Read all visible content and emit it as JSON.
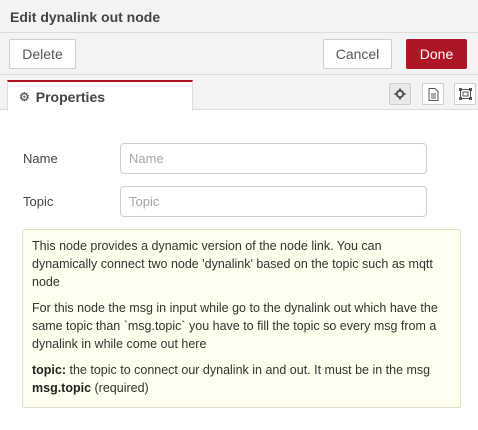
{
  "title": "Edit dynalink out node",
  "toolbar": {
    "delete_label": "Delete",
    "cancel_label": "Cancel",
    "done_label": "Done",
    "done_color": "#ad1625"
  },
  "tabs": {
    "properties_label": "Properties",
    "icons": [
      "gear-icon",
      "description-icon",
      "appearance-icon"
    ]
  },
  "form": {
    "name_label": "Name",
    "name_value": "",
    "name_placeholder": "Name",
    "topic_label": "Topic",
    "topic_value": "",
    "topic_placeholder": "Topic"
  },
  "help": {
    "para1": "This node provides a dynamic version of the node link. You can dynamically connect two node 'dynalink' based on the topic such as mqtt node",
    "para2": "For this node the msg in input while go to the dynalink out which have the same topic than `msg.topic` you have to fill the topic so every msg from a dynalink in while come out here",
    "para3_key": "topic:",
    "para3_text": " the topic to connect our dynalink in and out. It must be in the msg ",
    "para3_key2": "msg.topic",
    "para3_suffix": " (required)"
  }
}
